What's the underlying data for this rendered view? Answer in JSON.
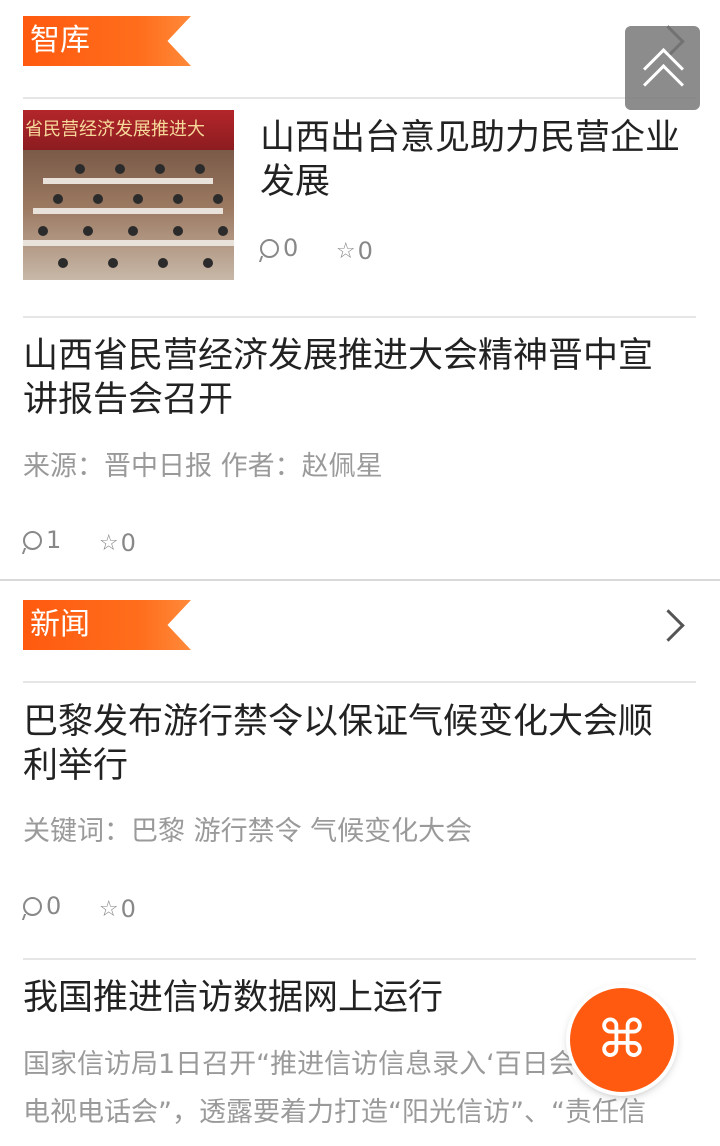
{
  "sections": {
    "zhiku": {
      "label": "智库"
    },
    "news": {
      "label": "新闻"
    }
  },
  "articles": [
    {
      "title": "山西出台意见助力民营企业发展",
      "thumbnail_banner_text": "省民营经济发展推进大",
      "comments": "0",
      "favorites": "0"
    },
    {
      "title": "山西省民营经济发展推进大会精神晋中宣讲报告会召开",
      "meta": "来源：晋中日报 作者：赵佩星",
      "comments": "1",
      "favorites": "0"
    },
    {
      "title": "巴黎发布游行禁令以保证气候变化大会顺利举行",
      "meta": "关键词：巴黎 游行禁令 气候变化大会",
      "comments": "0",
      "favorites": "0"
    },
    {
      "title": "我国推进信访数据网上运行",
      "summary_line1": "国家信访局1日召开“推进信访信息录入‘百日会战’动",
      "summary_line2": "电视电话会”，透露要着力打造“阳光信访”、“责任信"
    }
  ],
  "icons": {
    "section_more": "chevron-right-icon",
    "back_to_top": "double-chevron-up-icon",
    "fab": "command-icon",
    "comment": "comment-bubble-icon",
    "favorite": "star-outline-icon"
  },
  "colors": {
    "accent": "#ff5a10",
    "divider": "#e6e6e6",
    "meta_text": "#9a9a9a"
  }
}
